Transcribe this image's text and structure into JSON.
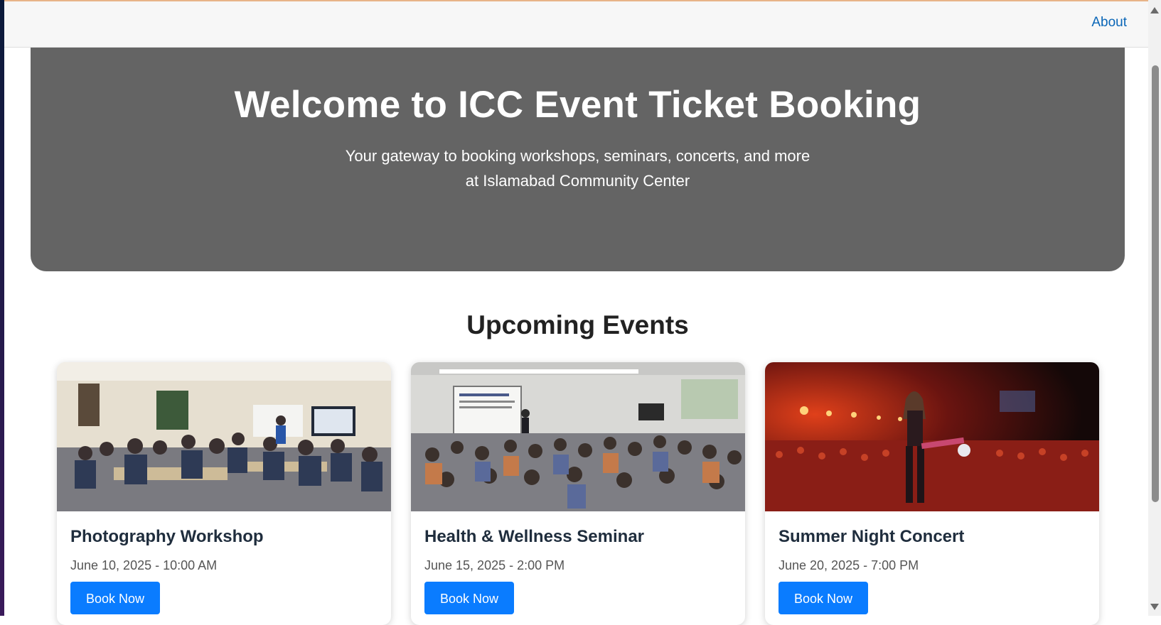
{
  "nav": {
    "about_label": "About"
  },
  "hero": {
    "title": "Welcome to ICC Event Ticket Booking",
    "subtitle_line1": "Your gateway to booking workshops, seminars, concerts, and more",
    "subtitle_line2": "at Islamabad Community Center"
  },
  "events_section": {
    "title": "Upcoming Events",
    "events": [
      {
        "name": "Photography Workshop",
        "datetime": "June 10, 2025 - 10:00 AM",
        "button": "Book Now"
      },
      {
        "name": "Health & Wellness Seminar",
        "datetime": "June 15, 2025 - 2:00 PM",
        "button": "Book Now"
      },
      {
        "name": "Summer Night Concert",
        "datetime": "June 20, 2025 - 7:00 PM",
        "button": "Book Now"
      }
    ]
  },
  "colors": {
    "hero_bg": "#646464",
    "button_bg": "#0a7cff",
    "nav_link": "#0a66b7"
  }
}
